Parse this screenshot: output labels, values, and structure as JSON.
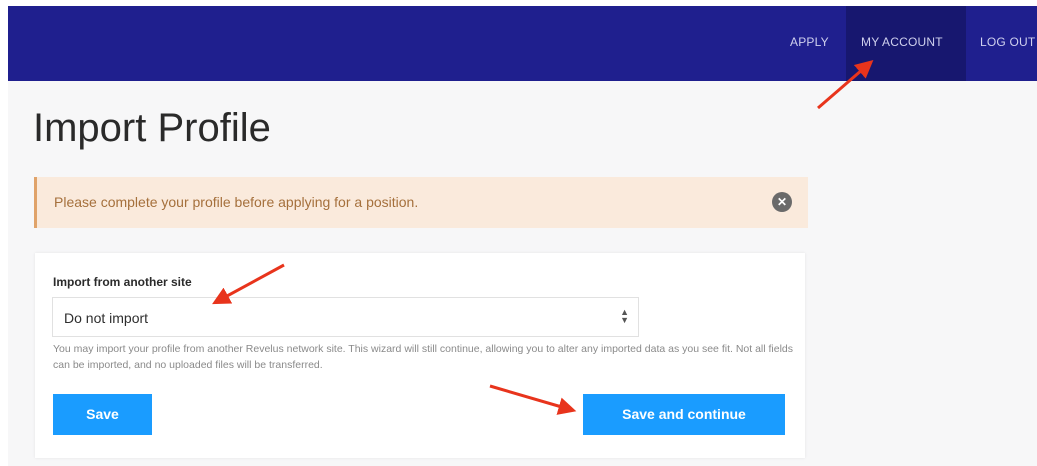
{
  "nav": {
    "items": [
      {
        "label": "APPLY"
      },
      {
        "label": "MY ACCOUNT"
      },
      {
        "label": "LOG OUT"
      }
    ]
  },
  "page": {
    "title": "Import Profile"
  },
  "alert": {
    "message": "Please complete your profile before applying for a position.",
    "close_icon": "close-icon"
  },
  "form": {
    "import_label": "Import from another site",
    "import_select": {
      "value": "Do not import"
    },
    "help_text": "You may import your profile from another Revelus network site. This wizard will still continue, allowing you to alter any imported data as you see fit. Not all fields can be imported, and no uploaded files will be transferred.",
    "save_label": "Save",
    "continue_label": "Save and continue"
  },
  "colors": {
    "navbar": "#1f1f8e",
    "alert_bg": "#faeadc",
    "button": "#1a9cff",
    "annotation_arrow": "#e8341c"
  }
}
